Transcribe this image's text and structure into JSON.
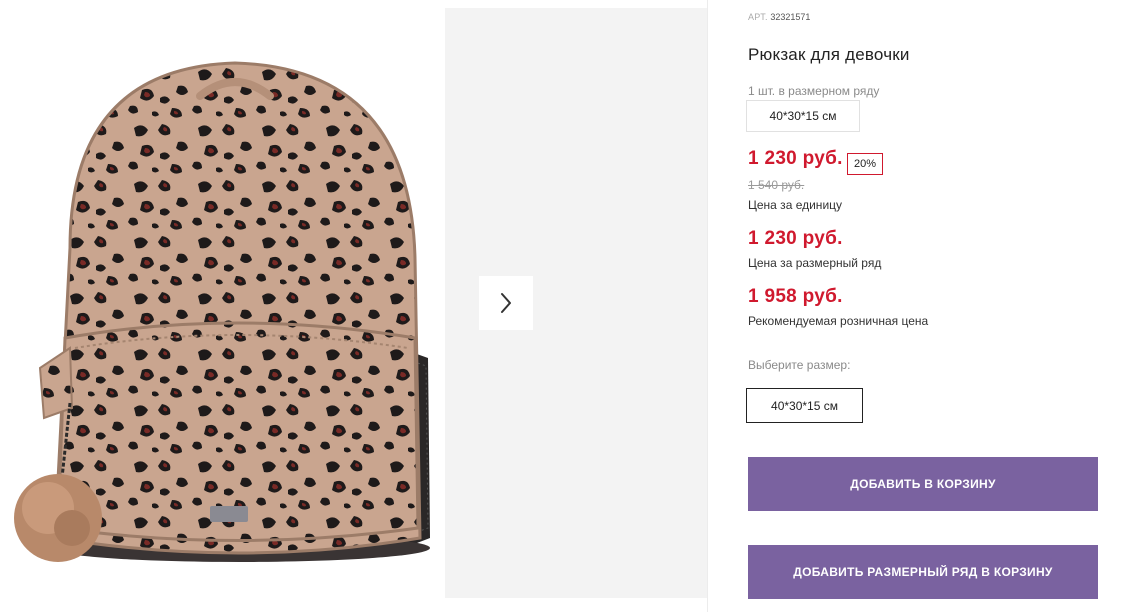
{
  "product": {
    "article_label": "АРТ.",
    "article_number": "32321571",
    "title": "Рюкзак для девочки",
    "pack_note": "1 шт. в размерном ряду",
    "pack_size": "40*30*15 см"
  },
  "pricing": {
    "unit_price": "1 230 руб.",
    "discount_badge": "20%",
    "old_price": "1 540 руб.",
    "unit_caption": "Цена за единицу",
    "set_price": "1 230 руб.",
    "set_caption": "Цена за размерный ряд",
    "retail_price": "1 958 руб.",
    "retail_caption": "Рекомендуемая розничная цена"
  },
  "size_selector": {
    "label": "Выберите размер:",
    "selected": "40*30*15 см"
  },
  "actions": {
    "add_to_cart": "ДОБАВИТЬ В КОРЗИНУ",
    "add_set_to_cart": "ДОБАВИТЬ РАЗМЕРНЫЙ РЯД В КОРЗИНУ"
  },
  "gallery": {
    "next_icon": "chevron-right-icon",
    "product_image": "leopard-print-backpack"
  },
  "colors": {
    "price_red": "#d0192e",
    "button_purple": "#7a62a0",
    "backpack_base": "#c9a58f",
    "spot_dark": "#1e1a1a",
    "spot_inner": "#7a2a26"
  }
}
